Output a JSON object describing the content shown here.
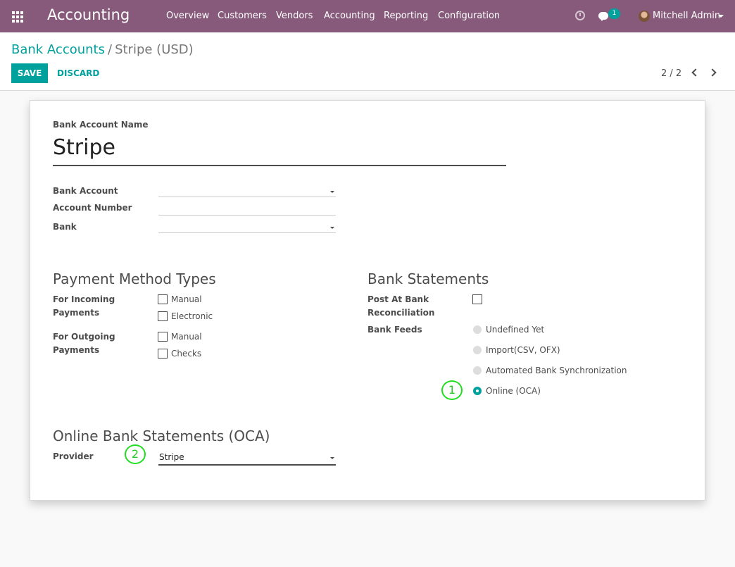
{
  "navbar": {
    "app_title": "Accounting",
    "menu": [
      "Overview",
      "Customers",
      "Vendors",
      "Accounting",
      "Reporting",
      "Configuration"
    ],
    "chat_count": "1",
    "user_name": "Mitchell Admin",
    "color": "#875a7b"
  },
  "breadcrumb": {
    "parent": "Bank Accounts",
    "separator": "/",
    "current": "Stripe (USD)"
  },
  "buttons": {
    "save": "SAVE",
    "discard": "DISCARD"
  },
  "pager": {
    "value": "2 / 2"
  },
  "form": {
    "name_label": "Bank Account Name",
    "name_value": "Stripe",
    "bank_account_label": "Bank Account",
    "bank_account_value": "",
    "account_number_label": "Account Number",
    "account_number_value": "",
    "bank_label": "Bank",
    "bank_value": ""
  },
  "payment_methods": {
    "title": "Payment Method Types",
    "incoming_label_line1": "For Incoming",
    "incoming_label_line2": "Payments",
    "incoming_options": [
      "Manual",
      "Electronic"
    ],
    "outgoing_label_line1": "For Outgoing",
    "outgoing_label_line2": "Payments",
    "outgoing_options": [
      "Manual",
      "Checks"
    ]
  },
  "bank_statements": {
    "title": "Bank Statements",
    "post_label_line1": "Post At Bank",
    "post_label_line2": "Reconciliation",
    "post_checked": false,
    "feeds_label": "Bank Feeds",
    "feeds_options": [
      "Undefined Yet",
      "Import(CSV, OFX)",
      "Automated Bank Synchronization",
      "Online (OCA)"
    ],
    "feeds_selected": "Online (OCA)"
  },
  "online": {
    "title": "Online Bank Statements (OCA)",
    "provider_label": "Provider",
    "provider_value": "Stripe"
  },
  "markers": [
    "1",
    "2"
  ],
  "accent_color": "#00a09d"
}
